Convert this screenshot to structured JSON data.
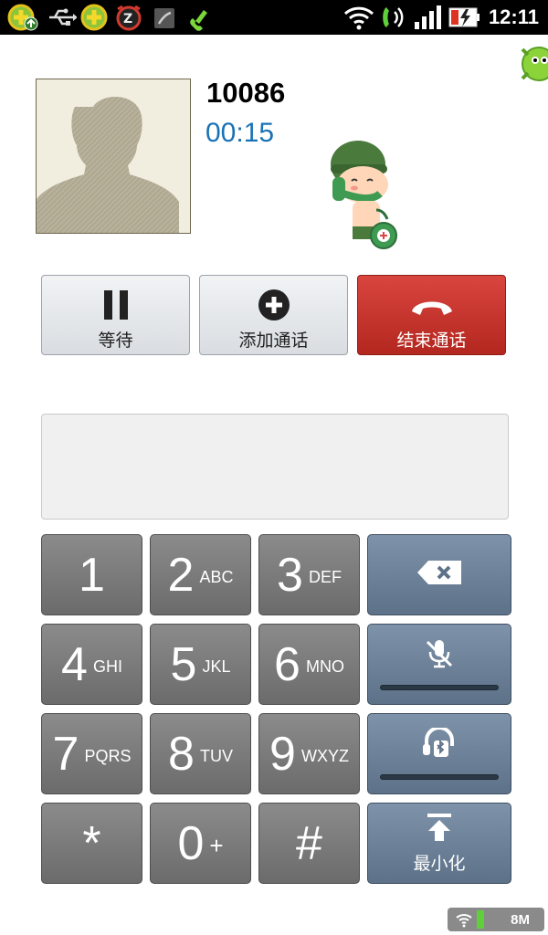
{
  "status_bar": {
    "time": "12:11",
    "icons": [
      "360-update-icon",
      "usb-icon",
      "360-icon",
      "alarm-icon",
      "sd-card-icon",
      "call-active-icon",
      "wifi-icon",
      "phone-speaker-icon",
      "signal-icon",
      "battery-charging-icon"
    ]
  },
  "caller": {
    "number": "10086",
    "duration": "00:15"
  },
  "actions": {
    "hold_label": "等待",
    "add_call_label": "添加通话",
    "end_call_label": "结束通话"
  },
  "keypad": {
    "keys": [
      {
        "digit": "1",
        "letters": ""
      },
      {
        "digit": "2",
        "letters": "ABC"
      },
      {
        "digit": "3",
        "letters": "DEF"
      },
      {
        "digit": "4",
        "letters": "GHI"
      },
      {
        "digit": "5",
        "letters": "JKL"
      },
      {
        "digit": "6",
        "letters": "MNO"
      },
      {
        "digit": "7",
        "letters": "PQRS"
      },
      {
        "digit": "8",
        "letters": "TUV"
      },
      {
        "digit": "9",
        "letters": "WXYZ"
      },
      {
        "digit": "*",
        "letters": ""
      },
      {
        "digit": "0",
        "letters": "+"
      },
      {
        "digit": "#",
        "letters": ""
      }
    ],
    "minimize_label": "最小化"
  },
  "network_badge": {
    "speed": "8M"
  },
  "colors": {
    "accent_timer": "#1a72b6",
    "end_call": "#c4322b",
    "key_gray": "#7a7a7a",
    "side_key_blue": "#6d8199"
  }
}
